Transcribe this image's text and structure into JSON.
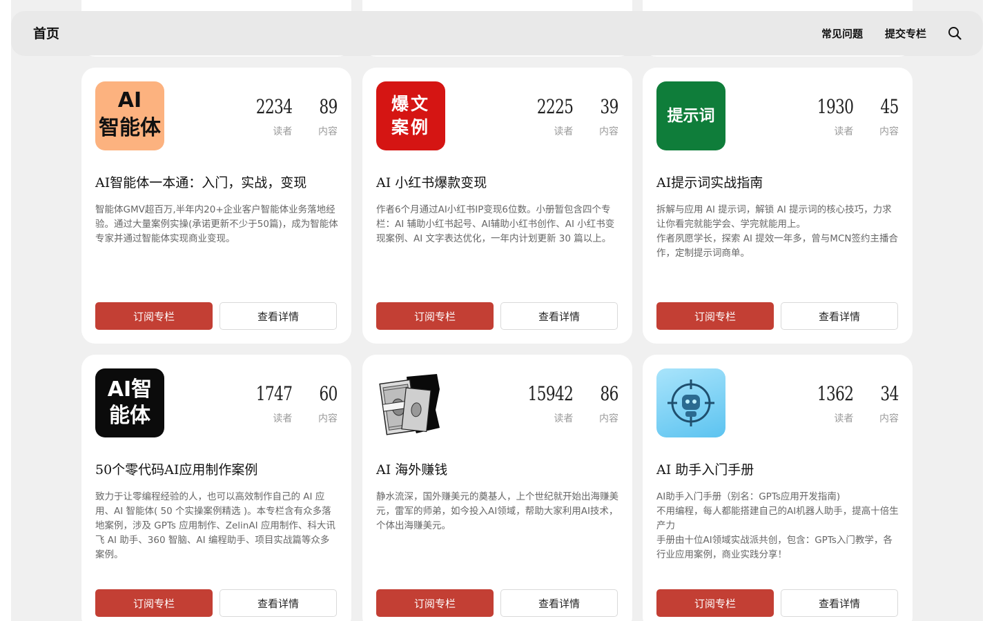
{
  "nav": {
    "home": "首页",
    "faq": "常见问题",
    "submit": "提交专栏",
    "search_icon": "search-icon"
  },
  "labels": {
    "readers": "读者",
    "contents": "内容",
    "subscribe": "订阅专栏",
    "details": "查看详情"
  },
  "cards": [
    {
      "icon_line1": "AI",
      "icon_line2": "智能体",
      "icon_bg": "#fcb27f",
      "readers": "2234",
      "contents": "89",
      "title": "AI智能体一本通：入门，实战，变现",
      "desc": "智能体GMV超百万,半年内20+企业客户智能体业务落地经验。通过大量案例实操(承诺更新不少于50篇)，成为智能体专家并通过智能体实现商业变现。"
    },
    {
      "icon_line1": "爆文",
      "icon_line2": "案例",
      "icon_bg": "#d51513",
      "readers": "2225",
      "contents": "39",
      "title": "AI 小红书爆款变现",
      "desc": "作者6个月通过AI小红书IP变现6位数。小册暂包含四个专栏：AI 辅助小红书起号、AI辅助小红书创作、AI 小红书变现案例、AI 文字表达优化，一年内计划更新 30 篇以上。"
    },
    {
      "icon_line1": "提示词",
      "icon_line2": "",
      "icon_bg": "#0f7d3a",
      "readers": "1930",
      "contents": "45",
      "title": "AI提示词实战指南",
      "desc": "拆解与应用 AI 提示词，解锁 AI 提示词的核心技巧，力求让你看完就能学会、学完就能用上。\n作者夙愿学长，探索 AI 提效一年多，曾与MCN签约主播合作，定制提示词商单。"
    },
    {
      "icon_line1": "AI智",
      "icon_line2": "能体",
      "icon_bg": "#0b0b0b",
      "readers": "1747",
      "contents": "60",
      "title": "50个零代码AI应用制作案例",
      "desc": "致力于让零编程经验的人，也可以高效制作自己的 AI 应用、AI 智能体( 50 个实操案例精选 )。本专栏含有众多落地案例，涉及 GPTs 应用制作、ZelinAI 应用制作、科大讯飞 AI 助手、360 智脑、AI 编程助手、项目实战篇等众多案例。"
    },
    {
      "icon_line1": "",
      "icon_line2": "",
      "icon_bg": "#ffffff",
      "readers": "15942",
      "contents": "86",
      "title": "AI 海外赚钱",
      "desc": "静水流深，国外赚美元的奠基人，上个世纪就开始出海赚美元，雷军的师弟，如今投入AI领域，帮助大家利用AI技术，个体出海赚美元。"
    },
    {
      "icon_line1": "",
      "icon_line2": "",
      "icon_bg": "#7fd3f7",
      "readers": "1362",
      "contents": "34",
      "title": "AI 助手入门手册",
      "desc": "AI助手入门手册（别名：GPTs应用开发指南)\n不用编程，每人都能搭建自己的AI机器人助手，提高十倍生产力\n手册由十位AI领域实战派共创，包含：GPTs入门教学，各行业应用案例，商业实践分享！"
    }
  ]
}
